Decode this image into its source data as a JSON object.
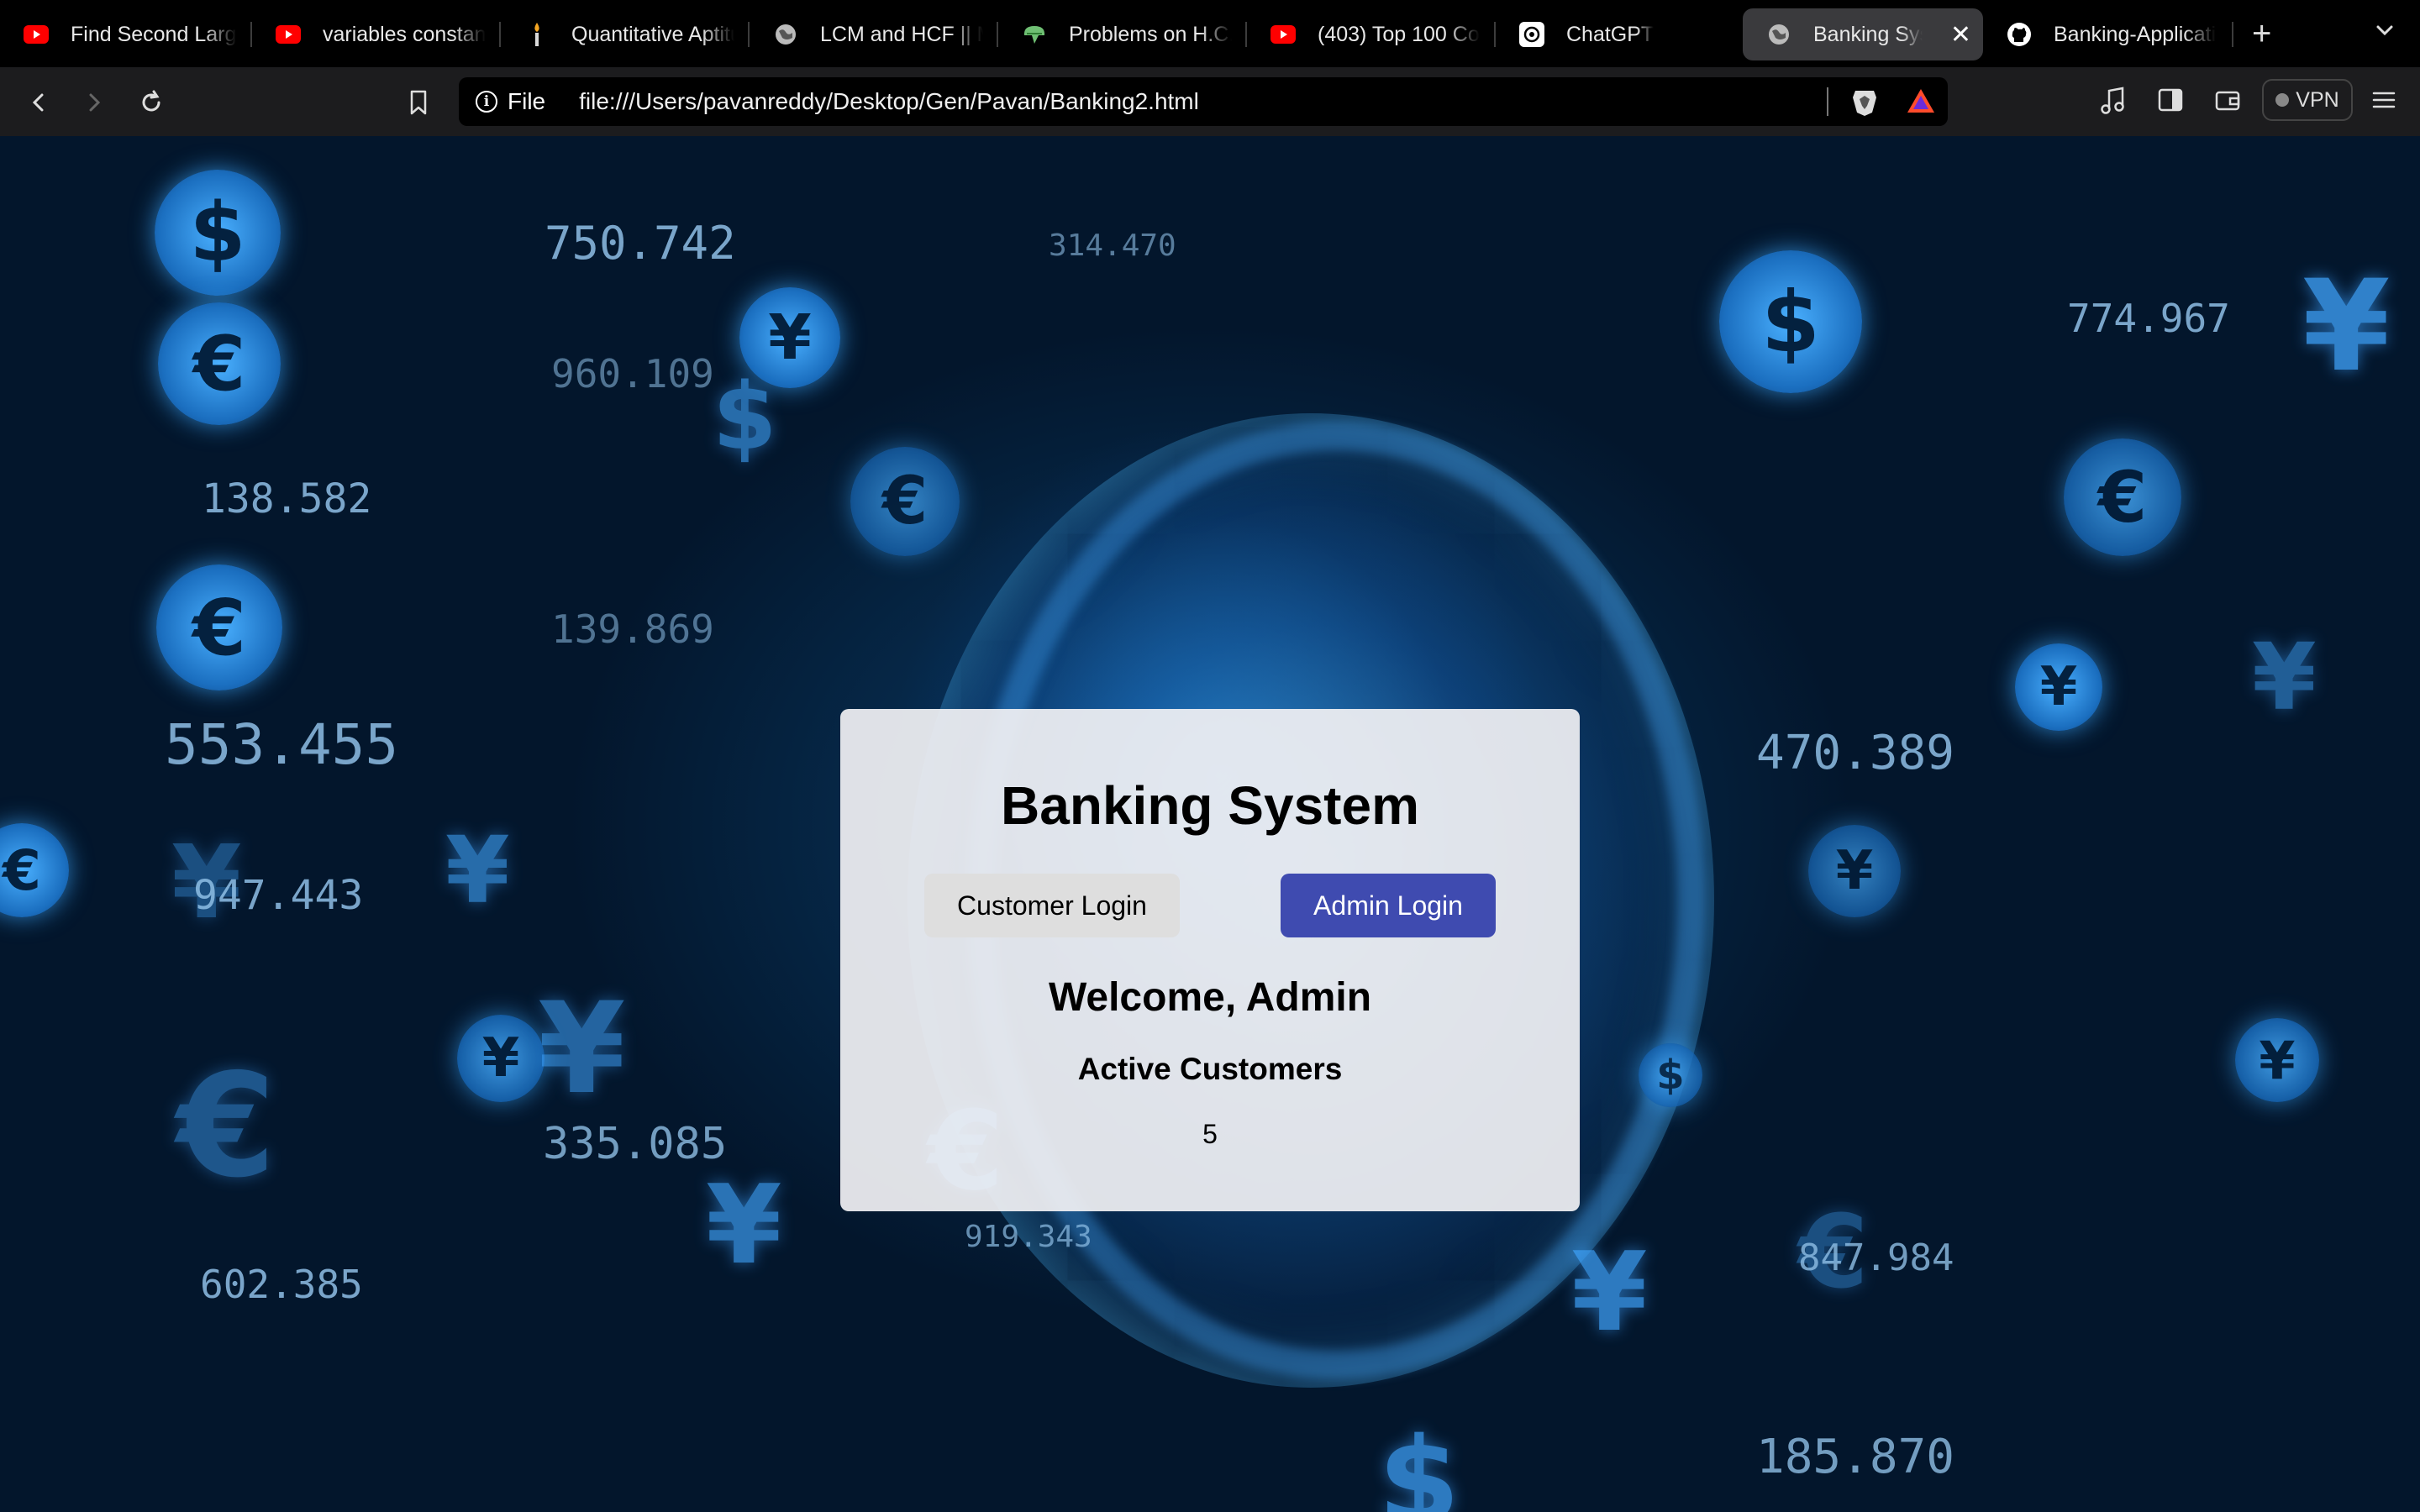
{
  "browser": {
    "tabs": [
      {
        "title": "Find Second Large",
        "icon": "youtube-icon",
        "active": false
      },
      {
        "title": "variables constant",
        "icon": "youtube-icon",
        "active": false
      },
      {
        "title": "Quantitative Aptitu",
        "icon": "candle-icon",
        "active": false
      },
      {
        "title": "LCM and HCF || M",
        "icon": "globe-icon",
        "active": false
      },
      {
        "title": "Problems on H.C.F",
        "icon": "brain-icon",
        "active": false
      },
      {
        "title": "(403) Top 100 Co",
        "icon": "youtube-icon",
        "active": false
      },
      {
        "title": "ChatGPT",
        "icon": "chatgpt-icon",
        "active": false
      },
      {
        "title": "Banking Syste",
        "icon": "globe-icon",
        "active": true
      },
      {
        "title": "Banking-Applicati",
        "icon": "github-icon",
        "active": false
      }
    ],
    "address": {
      "scheme_label": "File",
      "url": "file:///Users/pavanreddy/Desktop/Gen/Pavan/Banking2.html"
    },
    "vpn_label": "VPN"
  },
  "page": {
    "title": "Banking System",
    "customer_login_label": "Customer Login",
    "admin_login_label": "Admin Login",
    "welcome": "Welcome, Admin",
    "section_title": "Active Customers",
    "active_count": "5"
  },
  "colors": {
    "admin_button": "#3f4bb0",
    "customer_button": "#dedede",
    "card_background": "#f0f0f3",
    "page_background": "#03162c"
  }
}
